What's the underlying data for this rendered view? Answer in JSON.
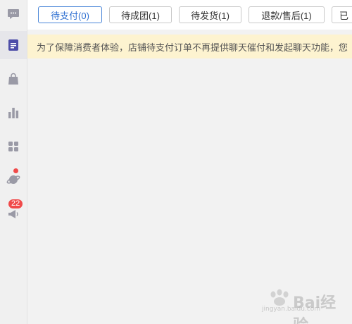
{
  "sidebar": {
    "items": [
      {
        "icon": "chat-icon"
      },
      {
        "icon": "orders-icon",
        "active": true
      },
      {
        "icon": "shopping-bag-icon"
      },
      {
        "icon": "bar-chart-icon"
      },
      {
        "icon": "apps-grid-icon"
      },
      {
        "icon": "planet-icon",
        "has_dot": true
      },
      {
        "icon": "megaphone-icon",
        "badge": "22"
      }
    ]
  },
  "tabs": [
    {
      "label": "待支付(0)",
      "active": true
    },
    {
      "label": "待成团(1)"
    },
    {
      "label": "待发货(1)"
    },
    {
      "label": "退款/售后(1)"
    },
    {
      "label": "已"
    }
  ],
  "notice": {
    "text": "为了保障消费者体验，店铺待支付订单不再提供聊天催付和发起聊天功能，您"
  },
  "watermark": {
    "brand": "Bai经验",
    "sub": "jingyan.baidu.com"
  },
  "colors": {
    "accent": "#2e6fd1",
    "notice_bg": "#fdf3d0",
    "badge": "#f04a4a",
    "sidebar_icon": "#9a9aa6",
    "active_icon": "#4e4ea8"
  }
}
